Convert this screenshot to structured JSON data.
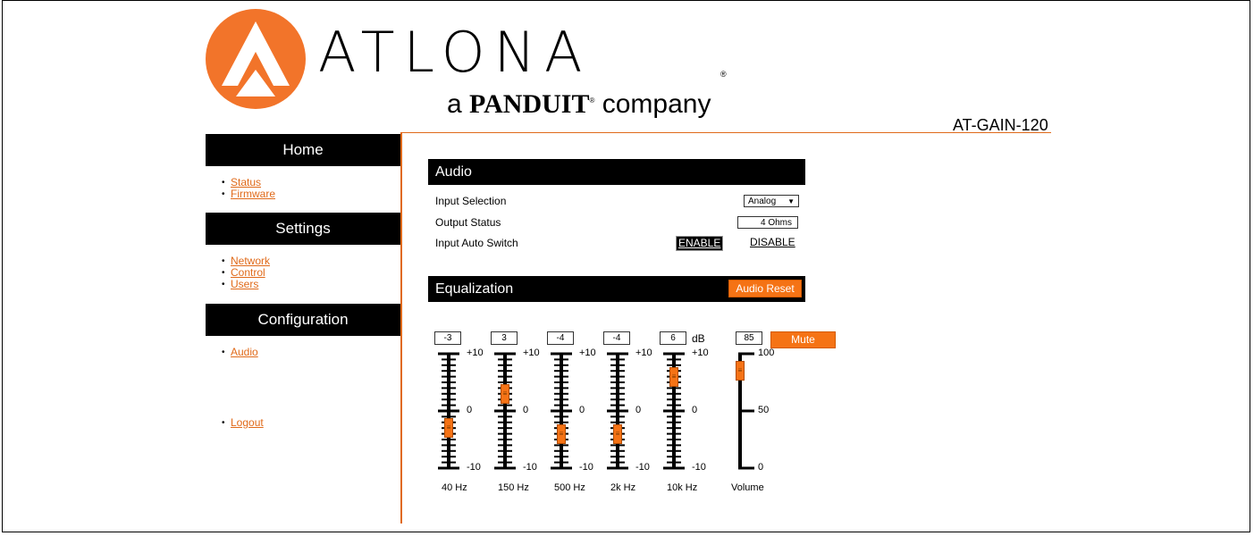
{
  "brand": {
    "name": "ATLONA",
    "tagline_a": "a",
    "tagline_brand": "PANDUIT",
    "tagline_company": "company",
    "registered": "®",
    "logo_color": "#f2742a"
  },
  "model": "AT-GAIN-120",
  "nav": {
    "home": {
      "title": "Home",
      "items": [
        "Status",
        "Firmware"
      ]
    },
    "settings": {
      "title": "Settings",
      "items": [
        "Network",
        "Control",
        "Users"
      ]
    },
    "configuration": {
      "title": "Configuration",
      "items": [
        "Audio"
      ]
    },
    "logout": "Logout"
  },
  "audio": {
    "title": "Audio",
    "input_selection_label": "Input Selection",
    "input_selection_value": "Analog",
    "output_status_label": "Output Status",
    "output_status_value": "4 Ohms",
    "auto_switch_label": "Input Auto Switch",
    "enable_label": "ENABLE",
    "disable_label": "DISABLE",
    "auto_switch_state": "ENABLE"
  },
  "eq": {
    "title": "Equalization",
    "reset_label": "Audio Reset",
    "unit": "dB",
    "range": [
      -10,
      10
    ],
    "scale_top": "+10",
    "scale_mid": "0",
    "scale_bottom": "-10",
    "bands": [
      {
        "label": "40 Hz",
        "value": "-3",
        "level": -3
      },
      {
        "label": "150 Hz",
        "value": "3",
        "level": 3
      },
      {
        "label": "500 Hz",
        "value": "-4",
        "level": -4
      },
      {
        "label": "2k Hz",
        "value": "-4",
        "level": -4
      },
      {
        "label": "10k Hz",
        "value": "6",
        "level": 6
      }
    ],
    "volume": {
      "label": "Volume",
      "value": "85",
      "level": 85,
      "range": [
        0,
        100
      ],
      "scale_top": "100",
      "scale_mid": "50",
      "scale_bottom": "0"
    },
    "mute_label": "Mute",
    "accent": "#f57315"
  }
}
